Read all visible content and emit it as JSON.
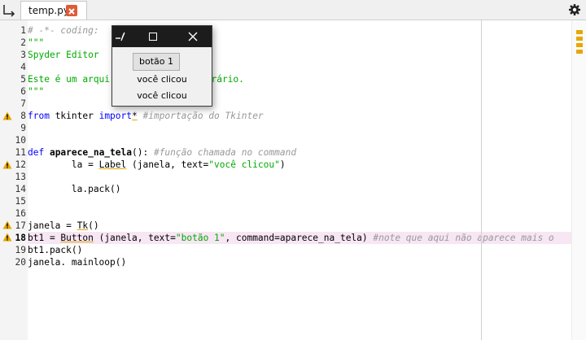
{
  "tab_bar": {
    "browse_icon": "browse-tabs-icon",
    "active_tab": {
      "filename": "temp.py",
      "close_icon": "close-tab-icon"
    },
    "options_icon": "gear-icon"
  },
  "editor": {
    "current_line": 18,
    "warning_lines": [
      8,
      12,
      17,
      18
    ],
    "lines": [
      {
        "n": "1",
        "text": "# -*- coding: "
      },
      {
        "n": "2",
        "text": "\"\"\""
      },
      {
        "n": "3",
        "text": "Spyder Editor"
      },
      {
        "n": "4",
        "text": ""
      },
      {
        "n": "5",
        "text": "Este é um arqui",
        "text_tail": "porário."
      },
      {
        "n": "6",
        "text": "\"\"\""
      },
      {
        "n": "7",
        "text": ""
      },
      {
        "n": "8",
        "kw1": "from",
        "mid": " tkinter ",
        "kw2": "import",
        "star": "*",
        "comment": " #importação do Tkinter"
      },
      {
        "n": "9",
        "text": ""
      },
      {
        "n": "10",
        "text": ""
      },
      {
        "n": "11",
        "kw": "def",
        "name": " aparece_na_tela",
        "rest": "(): ",
        "comment": "#função chamada no command"
      },
      {
        "n": "12",
        "indent": "        la = ",
        "cls": "Label",
        "mid": " (janela, text=",
        "str": "\"você clicou\"",
        "end": ")"
      },
      {
        "n": "13",
        "text": ""
      },
      {
        "n": "14",
        "text": "        la.pack()"
      },
      {
        "n": "15",
        "text": ""
      },
      {
        "n": "16",
        "text": ""
      },
      {
        "n": "17",
        "pre": "janela = ",
        "cls": "Tk",
        "end": "()"
      },
      {
        "n": "18",
        "pre": "bt1 = ",
        "cls": "Button",
        "mid": " (janela, text=",
        "str": "\"botão 1\"",
        "mid2": ", command=aparece_na_tela) ",
        "comment": "#note que aqui não aparece mais o"
      },
      {
        "n": "19",
        "text": "bt1.pack()"
      },
      {
        "n": "20",
        "text": "janela. mainloop()"
      }
    ]
  },
  "tk_window": {
    "app_icon": "tk-feather-icon",
    "maximize_icon": "maximize-icon",
    "close_icon": "close-icon",
    "button_label": "botão 1",
    "labels": [
      "você clicou",
      "você clicou"
    ]
  },
  "colors": {
    "keyword": "#0000ff",
    "string": "#00aa00",
    "comment": "#999999",
    "current_line_bg": "#f7e6f4",
    "warning": "#e6a800",
    "tab_close": "#e05a35"
  }
}
